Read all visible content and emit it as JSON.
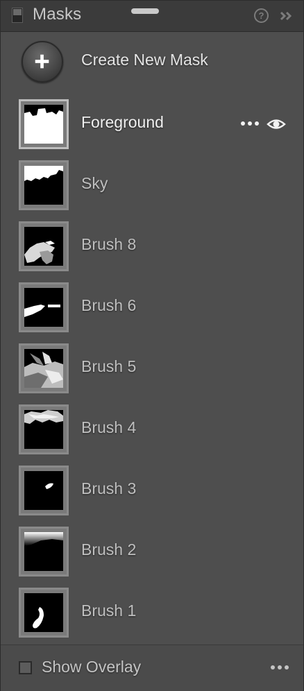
{
  "panel": {
    "title": "Masks",
    "panel_toggle_icon": "panel-toggle-icon",
    "help_icon": "help-icon",
    "help_glyph": "?",
    "collapse_icon": "double-chevron-right-icon"
  },
  "create": {
    "label": "Create New Mask",
    "icon": "plus-icon"
  },
  "masks": [
    {
      "label": "Foreground",
      "selected": true,
      "thumb": "foreground"
    },
    {
      "label": "Sky",
      "selected": false,
      "thumb": "sky"
    },
    {
      "label": "Brush 8",
      "selected": false,
      "thumb": "brush8"
    },
    {
      "label": "Brush 6",
      "selected": false,
      "thumb": "brush6"
    },
    {
      "label": "Brush 5",
      "selected": false,
      "thumb": "brush5"
    },
    {
      "label": "Brush 4",
      "selected": false,
      "thumb": "brush4"
    },
    {
      "label": "Brush 3",
      "selected": false,
      "thumb": "brush3"
    },
    {
      "label": "Brush 2",
      "selected": false,
      "thumb": "brush2"
    },
    {
      "label": "Brush 1",
      "selected": false,
      "thumb": "brush1"
    }
  ],
  "selected_actions": {
    "more_icon": "more-options-icon",
    "visibility_icon": "eye-icon"
  },
  "footer": {
    "show_overlay_label": "Show Overlay",
    "show_overlay_checked": false,
    "more_icon": "more-options-icon"
  },
  "colors": {
    "panel_bg": "#4e4e4e",
    "titlebar_bg": "#3b3b3b",
    "selected_text": "#f0f0f0",
    "text": "#bfbfbf"
  }
}
